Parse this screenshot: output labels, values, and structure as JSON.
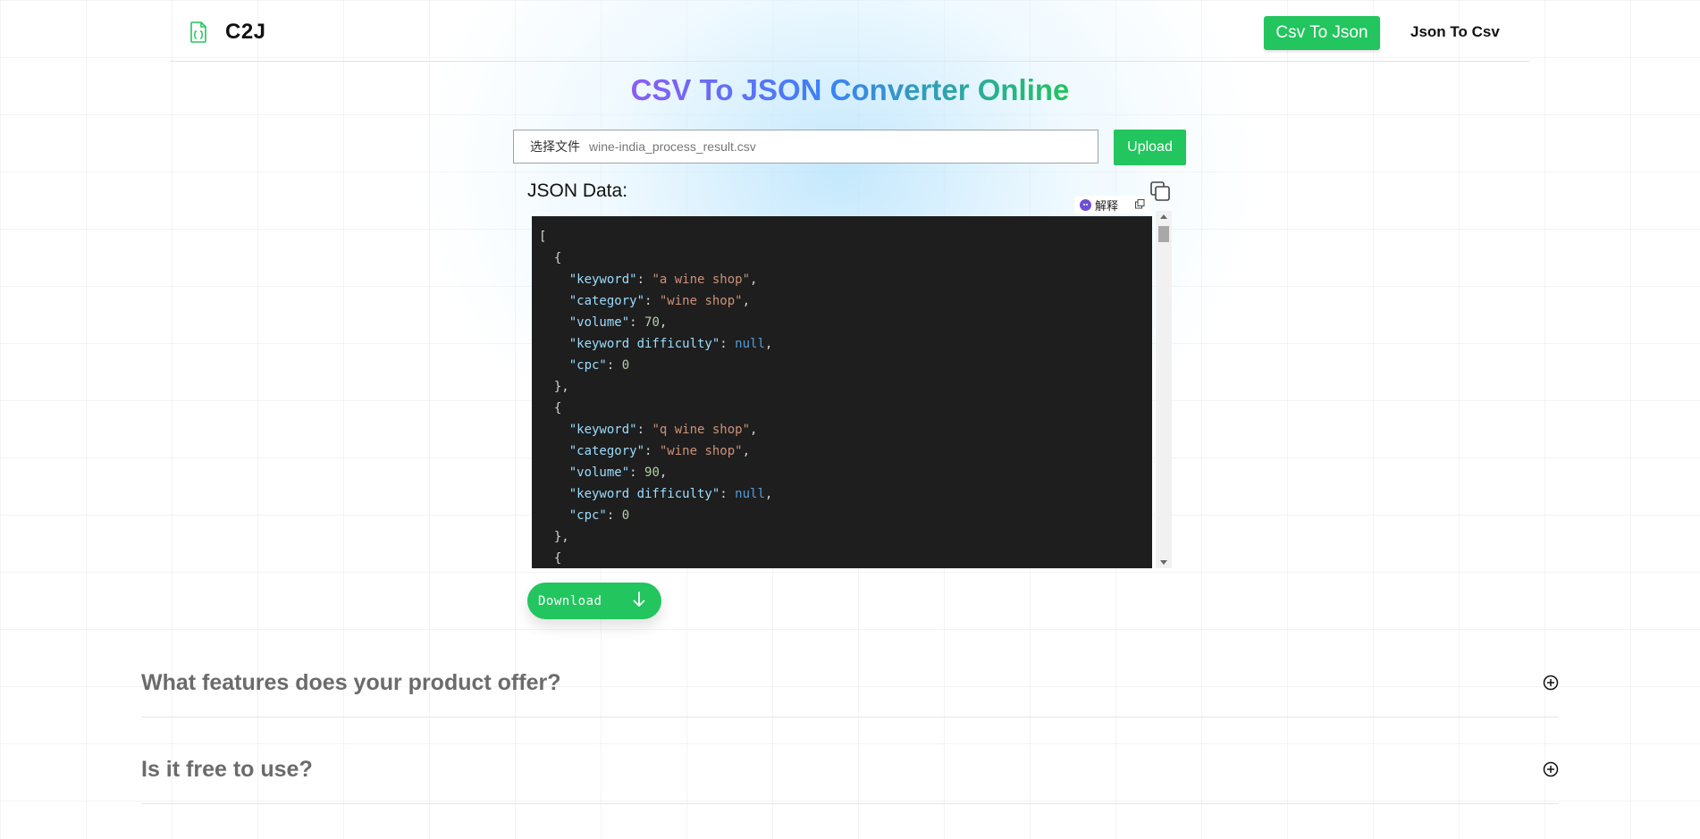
{
  "header": {
    "logo_icon": "json-file-icon",
    "logo_text": "C2J",
    "nav_primary": "Csv To Json",
    "nav_secondary": "Json To Csv"
  },
  "main": {
    "title": "CSV To JSON Converter Online",
    "file_input": {
      "button_label": "选择文件",
      "file_name": "wine-india_process_result.csv"
    },
    "upload_label": "Upload",
    "json_label": "JSON Data:",
    "copy_icon": "copy-icon",
    "extension_badge": {
      "label": "解释"
    },
    "json_records": [
      {
        "keyword": "a wine shop",
        "category": "wine shop",
        "volume": "70",
        "keyword difficulty": "null",
        "cpc": "0"
      },
      {
        "keyword": "q wine shop",
        "category": "wine shop",
        "volume": "90",
        "keyword difficulty": "null",
        "cpc": "0"
      }
    ],
    "download_label": "Download",
    "download_icon": "arrow-down-icon"
  },
  "faq": [
    {
      "question": "What features does your product offer?",
      "icon": "plus-circle-icon"
    },
    {
      "question": "Is it free to use?",
      "icon": "plus-circle-icon"
    }
  ],
  "colors": {
    "accent_green": "#22c55e",
    "title_gradient": [
      "#8b5cf6",
      "#3b82f6",
      "#22c55e"
    ],
    "code_bg": "#1e1e1e",
    "code_key": "#9cdcfe",
    "code_string": "#ce9178",
    "code_number": "#b5cea8",
    "code_null": "#569cd6"
  }
}
